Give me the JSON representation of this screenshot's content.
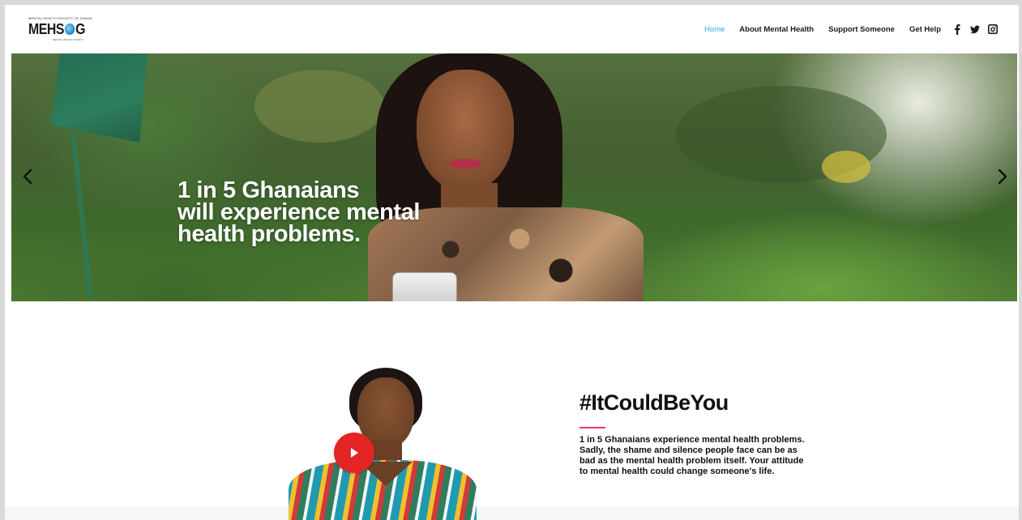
{
  "header": {
    "logo": {
      "tagline": "MENTAL HEALTH SOCIETY OF GHANA",
      "word_left": "MEHS",
      "word_right": "G",
      "sub": "MENTAL HEALTH SOCIETY"
    },
    "nav": [
      {
        "label": "Home",
        "active": true
      },
      {
        "label": "About Mental Health",
        "active": false
      },
      {
        "label": "Support Someone",
        "active": false
      },
      {
        "label": "Get Help",
        "active": false
      }
    ],
    "social": [
      "facebook-icon",
      "twitter-icon",
      "instagram-icon"
    ],
    "accent_color": "#2bb0e0"
  },
  "hero": {
    "lines": [
      "1 in 5 Ghanaians",
      "will experience mental",
      "health problems."
    ],
    "arrow_left": "chevron-left-icon",
    "arrow_right": "chevron-right-icon"
  },
  "feature": {
    "hashtag": "#ItCouldBeYou",
    "accent_color": "#e8356d",
    "play_color": "#e42525",
    "body": "1 in 5 Ghanaians experience mental health problems. Sadly, the shame and silence people face can be as bad as the mental health problem itself. Your attitude to mental health could change someone's life."
  }
}
